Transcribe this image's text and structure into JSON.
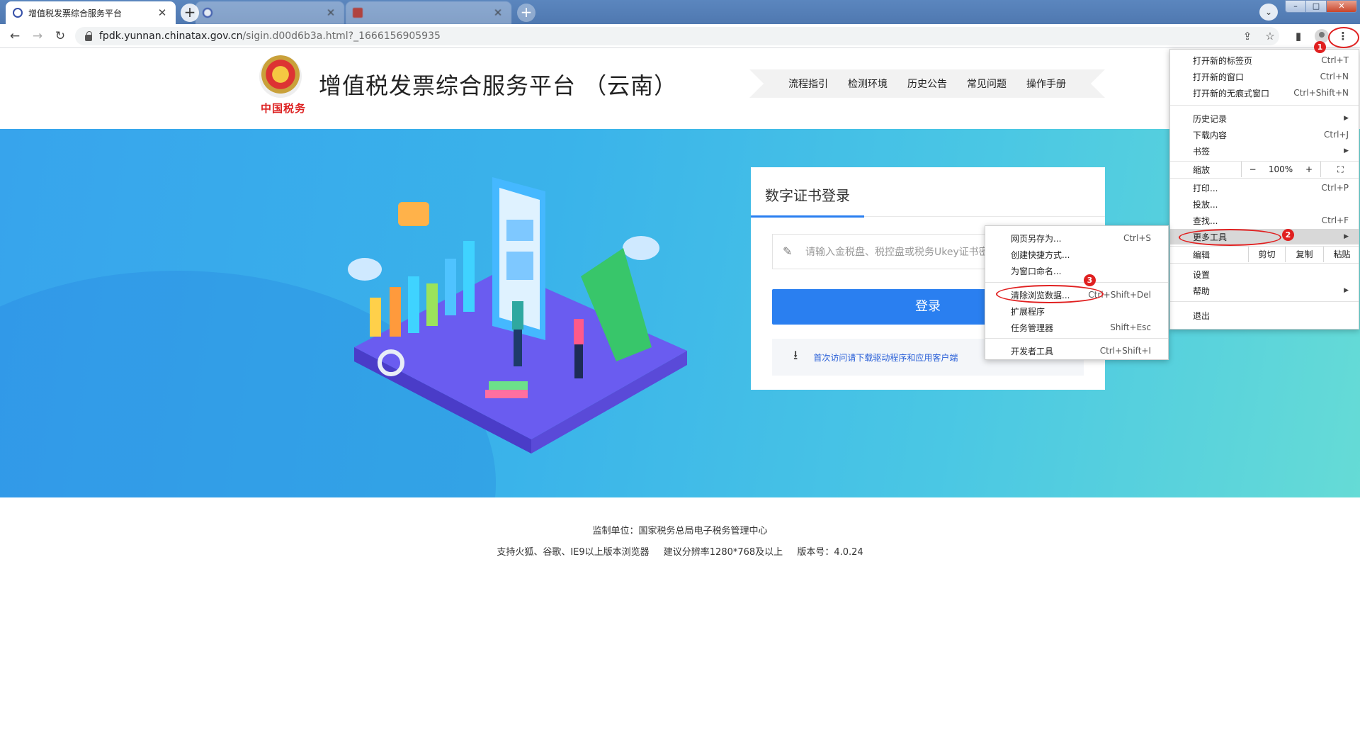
{
  "browser": {
    "tabs": [
      {
        "title": "增值税发票综合服务平台",
        "active": true
      },
      {
        "title": "",
        "active": false
      },
      {
        "title": "",
        "active": false
      }
    ],
    "url_host": "fpdk.yunnan.chinatax.gov.cn",
    "url_path": "/sigin.d00d6b3a.html?_1666156905935",
    "icons": {
      "back": "←",
      "forward": "→",
      "reload": "↻",
      "share": "⇪",
      "star": "☆",
      "side_panel": "▮",
      "kebab": "⋮",
      "new_tab": "+",
      "tab_search": "⌄",
      "close_tab": "✕",
      "minimize": "–",
      "maximize": "□",
      "close_window": "✕"
    }
  },
  "site": {
    "emblem_text": "中国税务",
    "title": "增值税发票综合服务平台 （云南）",
    "nav": [
      "流程指引",
      "检测环境",
      "历史公告",
      "常见问题",
      "操作手册"
    ]
  },
  "login": {
    "tab_title": "数字证书登录",
    "input_placeholder": "请输入金税盘、税控盘或税务Ukey证书密码",
    "button": "登录",
    "download_link": "首次访问请下载驱动程序和应用客户端",
    "pen_icon": "✎",
    "download_icon": "⭳"
  },
  "footer": {
    "line1": "监制单位：国家税务总局电子税务管理中心",
    "browsers": "支持火狐、谷歌、IE9以上版本浏览器",
    "resolution": "建议分辨率1280*768及以上",
    "version": "版本号：4.0.24"
  },
  "chrome_menu": {
    "new_tab": {
      "label": "打开新的标签页",
      "shortcut": "Ctrl+T"
    },
    "new_window": {
      "label": "打开新的窗口",
      "shortcut": "Ctrl+N"
    },
    "incognito": {
      "label": "打开新的无痕式窗口",
      "shortcut": "Ctrl+Shift+N"
    },
    "history": {
      "label": "历史记录"
    },
    "downloads": {
      "label": "下载内容",
      "shortcut": "Ctrl+J"
    },
    "bookmarks": {
      "label": "书签"
    },
    "zoom": {
      "label": "缩放",
      "minus": "−",
      "value": "100%",
      "plus": "+",
      "fullscreen": "⛶"
    },
    "print": {
      "label": "打印...",
      "shortcut": "Ctrl+P"
    },
    "cast": {
      "label": "投放..."
    },
    "find": {
      "label": "查找...",
      "shortcut": "Ctrl+F"
    },
    "more_tools": {
      "label": "更多工具"
    },
    "edit": {
      "label": "编辑",
      "cut": "剪切",
      "copy": "复制",
      "paste": "粘贴"
    },
    "settings": {
      "label": "设置"
    },
    "help": {
      "label": "帮助"
    },
    "exit": {
      "label": "退出"
    },
    "submenu_arrow": "▶"
  },
  "more_tools_menu": {
    "save_page": {
      "label": "网页另存为...",
      "shortcut": "Ctrl+S"
    },
    "create_shortcut": {
      "label": "创建快捷方式..."
    },
    "name_window": {
      "label": "为窗口命名..."
    },
    "clear_data": {
      "label": "清除浏览数据...",
      "shortcut": "Ctrl+Shift+Del"
    },
    "extensions": {
      "label": "扩展程序"
    },
    "task_manager": {
      "label": "任务管理器",
      "shortcut": "Shift+Esc"
    },
    "dev_tools": {
      "label": "开发者工具",
      "shortcut": "Ctrl+Shift+I"
    }
  },
  "annotations": {
    "step1": "1",
    "step2": "2",
    "step3": "3"
  },
  "colors": {
    "accent": "#2a7ff0",
    "hero_start": "#37a4ec",
    "hero_end": "#65dbd6",
    "annotation_red": "#e02020"
  }
}
